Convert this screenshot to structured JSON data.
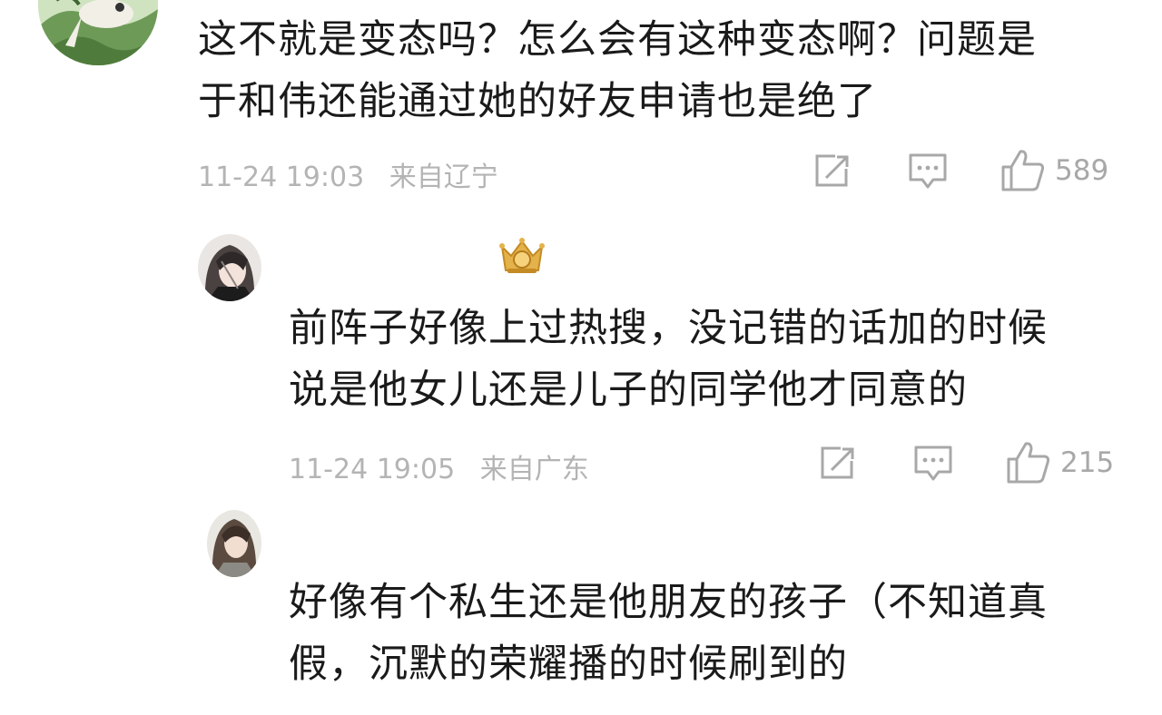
{
  "comments": [
    {
      "text_lines": [
        "这不就是变态吗？怎么会有这种变态啊？问题是",
        "于和伟还能通过她的好友申请也是绝了"
      ],
      "time": "11-24 19:03",
      "location": "来自辽宁",
      "likes": "589",
      "icons": [
        "forward-icon",
        "comment-icon",
        "thumbs-up-icon"
      ]
    }
  ],
  "replies": [
    {
      "text_lines": [
        "前阵子好像上过热搜，没记错的话加的时候",
        "说是他女儿还是儿子的同学他才同意的"
      ],
      "time": "11-24 19:05",
      "location": "来自广东",
      "likes": "215",
      "badge": "crown-badge-icon",
      "icons": [
        "forward-icon",
        "comment-icon",
        "thumbs-up-icon"
      ]
    },
    {
      "text_lines": [
        "好像有个私生还是他朋友的孩子（不知道真",
        "假，沉默的荣耀播的时候刷到的"
      ]
    }
  ],
  "colors": {
    "text": "#1a1a1a",
    "meta": "#b4b4b4",
    "icon": "#a8a8a8",
    "background": "#ffffff"
  }
}
